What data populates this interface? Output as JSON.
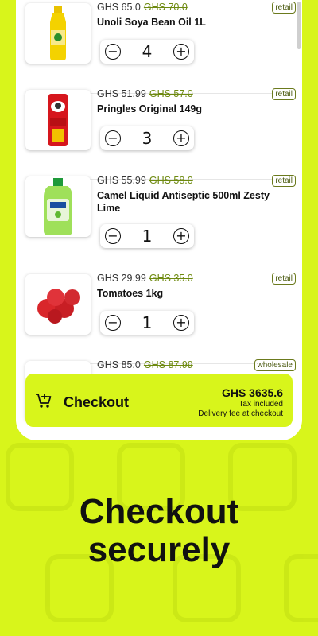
{
  "products": [
    {
      "price": "GHS 65.0",
      "old_price": "GHS 70.0",
      "badge": "retail",
      "name": "Unoli Soya Bean Oil 1L",
      "qty": "4",
      "image": "oil-bottle"
    },
    {
      "price": "GHS 51.99",
      "old_price": "GHS 57.0",
      "badge": "retail",
      "name": "Pringles Original 149g",
      "qty": "3",
      "image": "pringles-can"
    },
    {
      "price": "GHS 55.99",
      "old_price": "GHS 58.0",
      "badge": "retail",
      "name": "Camel Liquid Antiseptic 500ml Zesty Lime",
      "qty": "1",
      "image": "antiseptic-bottle"
    },
    {
      "price": "GHS 29.99",
      "old_price": "GHS 35.0",
      "badge": "retail",
      "name": "Tomatoes 1kg",
      "qty": "1",
      "image": "tomatoes"
    },
    {
      "price": "GHS 85.0",
      "old_price": "GHS 87.99",
      "badge": "wholesale",
      "name": "",
      "qty": "",
      "image": "green-pack"
    }
  ],
  "checkout": {
    "label": "Checkout",
    "total": "GHS 3635.6",
    "tax_note": "Tax included",
    "delivery_note": "Delivery fee at checkout"
  },
  "headline": {
    "line1": "Checkout",
    "line2": "securely"
  },
  "colors": {
    "accent": "#d8f51b",
    "old_price": "#6e8a10"
  }
}
